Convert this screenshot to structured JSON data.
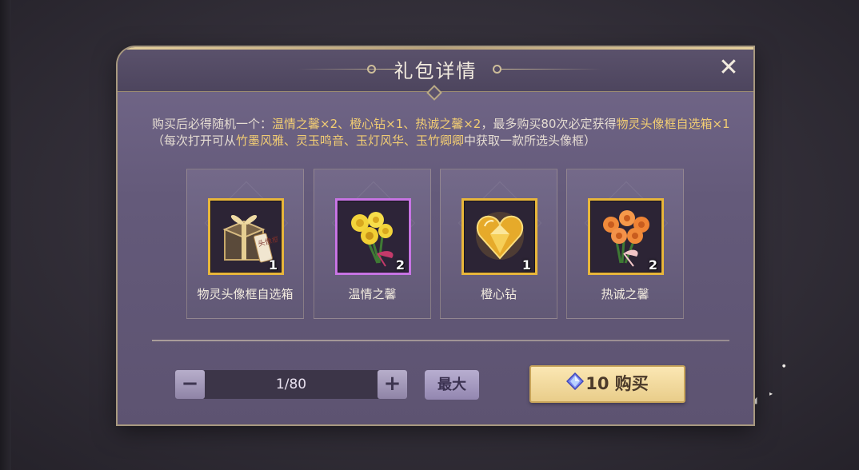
{
  "dialog": {
    "title": "礼包详情",
    "close_label": "✕"
  },
  "description": {
    "p1": "购买后必得随机一个：",
    "p2": "温情之馨×2、橙心钻×1、热诚之馨×2",
    "p3": "，最多购买80次必定获得",
    "p4": "物灵头像框自选箱×1",
    "p5": "（每次打开可从",
    "p6": "竹墨风雅、灵玉鸣音、玉灯风华、玉竹卿卿",
    "p7": "中获取一款所选头像框）"
  },
  "items": [
    {
      "name": "物灵头像框自选箱",
      "qty": "1",
      "frame": "gold",
      "tag_text": "头像框"
    },
    {
      "name": "温情之馨",
      "qty": "2",
      "frame": "purple"
    },
    {
      "name": "橙心钻",
      "qty": "1",
      "frame": "gold"
    },
    {
      "name": "热诚之馨",
      "qty": "2",
      "frame": "gold"
    }
  ],
  "quantity": {
    "minus_label": "−",
    "value": "1/80",
    "plus_label": "+",
    "max_label": "最大"
  },
  "buy": {
    "price": "10",
    "label": "购买"
  },
  "colors": {
    "highlight": "#f2cd73",
    "gold_frame": "#e8b63a",
    "purple_frame": "#c774e4"
  }
}
